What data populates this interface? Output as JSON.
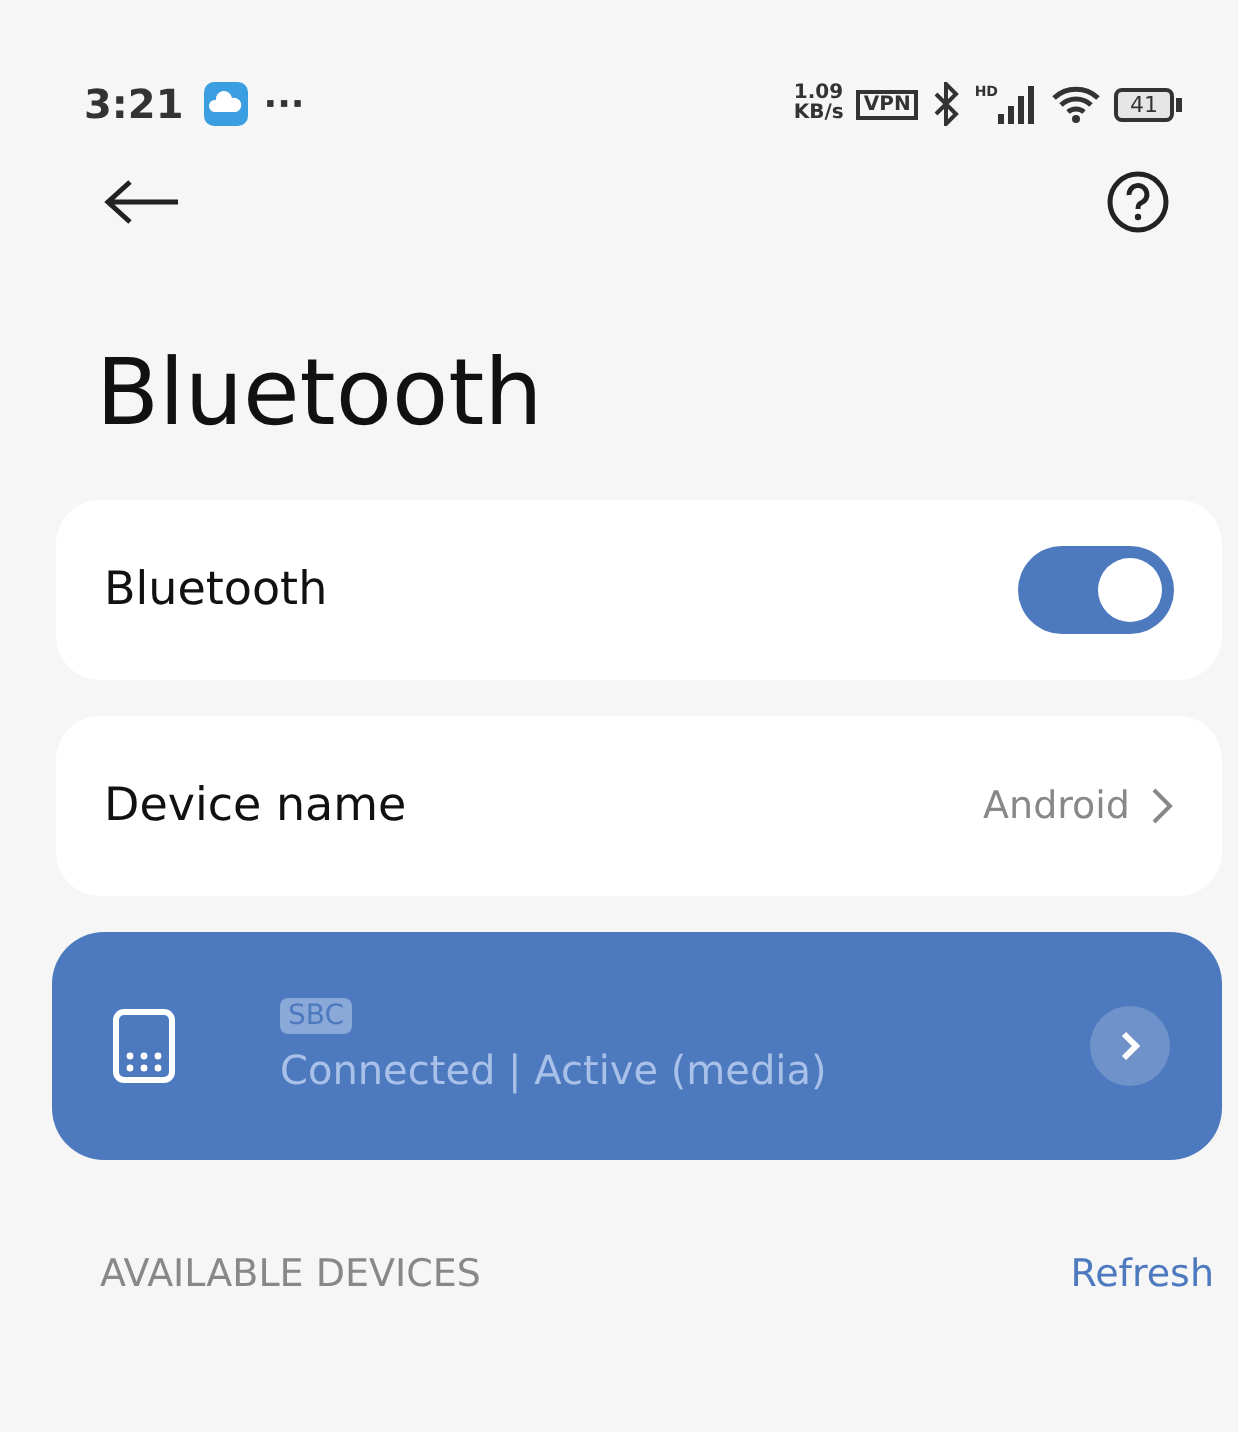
{
  "status_bar": {
    "time": "3:21",
    "more": "···",
    "speed_value": "1.09",
    "speed_unit": "KB/s",
    "vpn": "VPN",
    "signal_label": "HD",
    "battery": "41"
  },
  "title": "Bluetooth",
  "settings": [
    {
      "kind": "toggle",
      "label": "Bluetooth",
      "on": true
    },
    {
      "kind": "link",
      "label": "Device name",
      "value": "Android"
    }
  ],
  "connected_device": {
    "codec": "SBC",
    "status": "Connected | Active (media)"
  },
  "available_devices": {
    "heading": "AVAILABLE DEVICES",
    "action": "Refresh"
  }
}
